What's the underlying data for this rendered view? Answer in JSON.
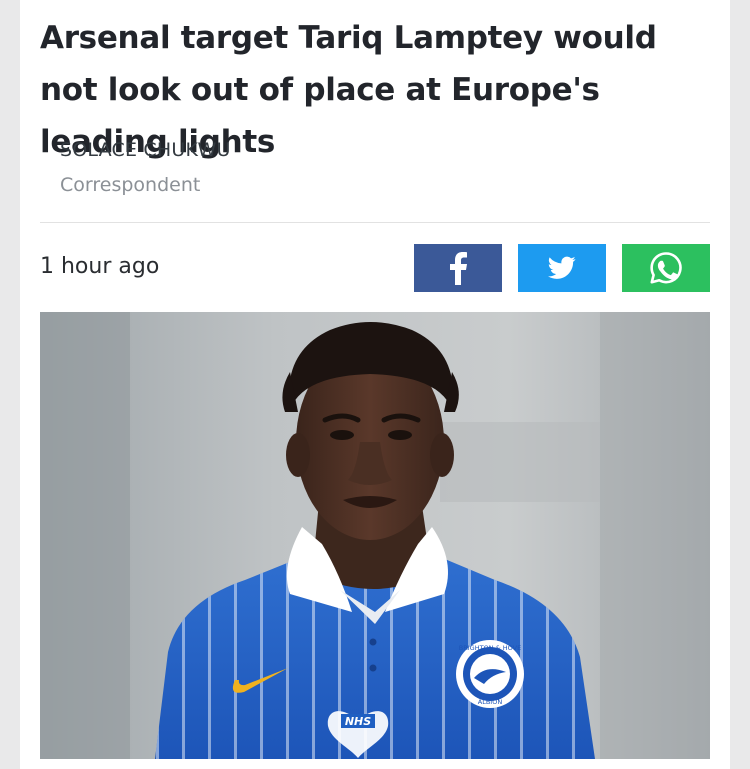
{
  "article": {
    "headline": "Arsenal target Tariq Lamptey would not look out of place at Europe's leading lights",
    "author_name": "SOLACE CHUKWU",
    "author_role": "Correspondent",
    "timestamp": "1 hour ago"
  },
  "share": {
    "buttons": [
      {
        "network": "facebook",
        "icon": "facebook-icon",
        "color": "#3b5998"
      },
      {
        "network": "twitter",
        "icon": "twitter-icon",
        "color": "#1d9bf0"
      },
      {
        "network": "whatsapp",
        "icon": "whatsapp-icon",
        "color": "#2cc05f"
      }
    ]
  },
  "image": {
    "badge_text": "NHS",
    "crest_top_text": "BRIGHTON & HOVE",
    "crest_bottom_text": "ALBION"
  }
}
